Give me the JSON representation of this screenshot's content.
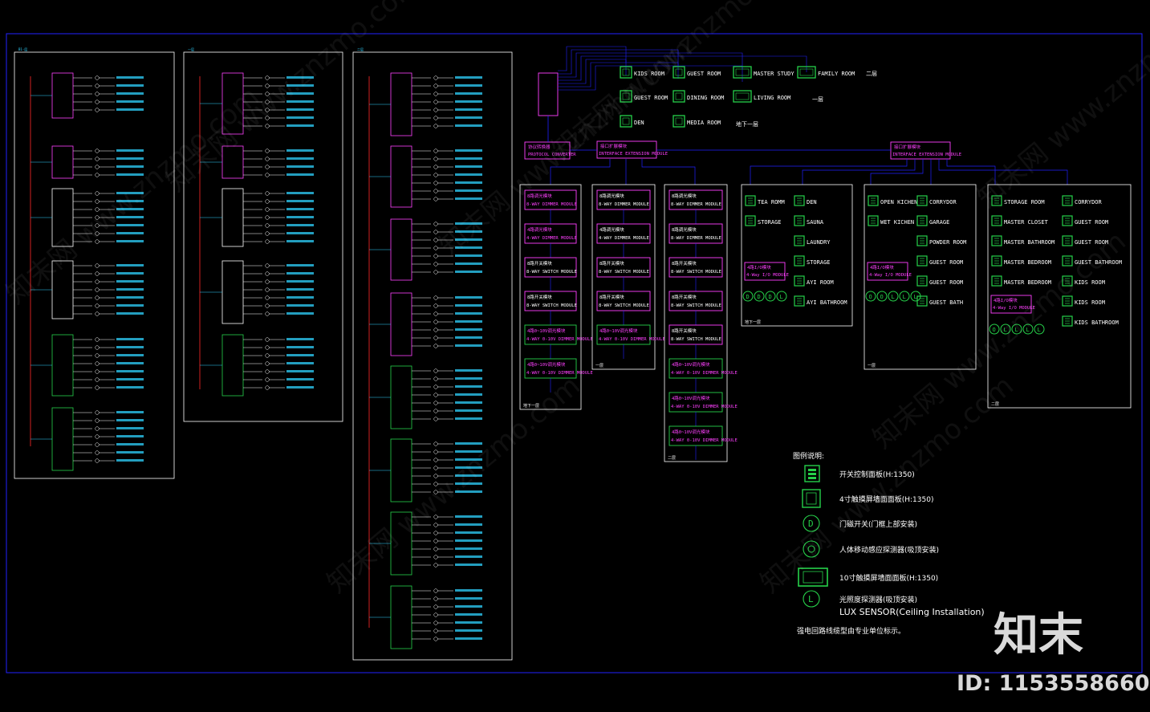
{
  "floors": {
    "f2_label": "二层",
    "f1_label": "一层",
    "fb1_label": "地下一层"
  },
  "touch_panel_rooms": [
    {
      "label": "KIDS ROOM"
    },
    {
      "label": "GUEST ROOM"
    },
    {
      "label": "MASTER STUDY"
    },
    {
      "label": "FAMILY ROOM"
    },
    {
      "label": "GUEST ROOM"
    },
    {
      "label": "DINING ROOM"
    },
    {
      "label": "LIVING ROOM"
    },
    {
      "label": "DEN"
    },
    {
      "label": "MEDIA ROOM"
    }
  ],
  "converter": {
    "cn": "协议转换器",
    "en": "PROTOCOL CONVERTER"
  },
  "extension_modules": [
    {
      "cn": "接口扩展模块",
      "en": "INTERFACE EXTENSION MODULE"
    },
    {
      "cn": "接口扩展模块",
      "en": "INTERFACE EXTENSION MODULE"
    }
  ],
  "module_columns": [
    {
      "floor": "地下一层",
      "modules": [
        {
          "cn": "8路调光模块",
          "en": "8-WAY DIMMER MODULE",
          "color": "#ff40ff"
        },
        {
          "cn": "4路调光模块",
          "en": "4-WAY DIMMER MODULE",
          "color": "#ff40ff"
        },
        {
          "cn": "8路开关模块",
          "en": "8-WAY SWITCH MODULE",
          "color": "#ffffff"
        },
        {
          "cn": "8路开关模块",
          "en": "8-WAY SWITCH MODULE",
          "color": "#ffffff"
        },
        {
          "cn": "4路0~10V调光模块",
          "en": "4-WAY 0-10V DIMMER MODULE",
          "color": "#ff40ff"
        },
        {
          "cn": "4路0~10V调光模块",
          "en": "4-WAY 0-10V DIMMER MODULE",
          "color": "#ff40ff"
        }
      ]
    },
    {
      "floor": "一层",
      "modules": [
        {
          "cn": "8路调光模块",
          "en": "8-WAY DIMMER MODULE",
          "color": "#ffffff"
        },
        {
          "cn": "4路调光模块",
          "en": "4-WAY DIMMER MODULE",
          "color": "#ffffff"
        },
        {
          "cn": "8路开关模块",
          "en": "8-WAY SWITCH MODULE",
          "color": "#ffffff"
        },
        {
          "cn": "8路开关模块",
          "en": "8-WAY SWITCH MODULE",
          "color": "#ffffff"
        },
        {
          "cn": "4路0~10V调光模块",
          "en": "4-WAY 0-10V DIMMER MODULE",
          "color": "#ff40ff"
        }
      ]
    },
    {
      "floor": "二层",
      "modules": [
        {
          "cn": "8路调光模块",
          "en": "8-WAY DIMMER MODULE",
          "color": "#ffffff"
        },
        {
          "cn": "8路调光模块",
          "en": "8-WAY DIMMER MODULE",
          "color": "#ffffff"
        },
        {
          "cn": "8路开关模块",
          "en": "8-WAY SWITCH MODULE",
          "color": "#ffffff"
        },
        {
          "cn": "8路开关模块",
          "en": "8-WAY SWITCH MODULE",
          "color": "#ffffff"
        },
        {
          "cn": "8路开关模块",
          "en": "8-WAY SWITCH MODULE",
          "color": "#ffffff"
        },
        {
          "cn": "4路0~10V调光模块",
          "en": "4-WAY 0-10V DIMMER MODULE",
          "color": "#ff40ff"
        },
        {
          "cn": "4路0~10V调光模块",
          "en": "4-WAY 0-10V DIMMER MODULE",
          "color": "#ff40ff"
        },
        {
          "cn": "4路0~10V调光模块",
          "en": "4-WAY 0-10V DIMMER MODULE",
          "color": "#ff40ff"
        }
      ]
    }
  ],
  "panel_groups": [
    {
      "floor": "地下一层",
      "left": [
        "TEA ROMM",
        "STORAGE"
      ],
      "right": [
        "DEN",
        "SAUNA",
        "LAUNDRY",
        "STORAGE",
        "AYI ROOM",
        "AYI BATHROOM"
      ],
      "io": "4路I/O模块",
      "io_en": "4-Way I/O MODULE",
      "sensors": [
        "D",
        "D",
        "D",
        "L"
      ]
    },
    {
      "floor": "一层",
      "left": [
        "OPEN KICHEN",
        "WET KICHEN"
      ],
      "right": [
        "CORRYDOR",
        "GARAGE",
        "POWDER ROOM",
        "GUEST ROOM",
        "GUEST ROOM",
        "GUEST BATH"
      ],
      "io": "4路I/O模块",
      "io_en": "4-Way I/O MODULE",
      "sensors": [
        "O",
        "O",
        "L",
        "L",
        "L"
      ]
    },
    {
      "floor": "二层",
      "left": [
        "STORAGE ROOM",
        "MASTER CLOSET",
        "MASTER BATHROOM",
        "MASTER BEDROOM",
        "MASTER BEDROOM"
      ],
      "right": [
        "CORRYDOR",
        "GUEST ROOM",
        "GUEST ROOM",
        "GUEST BATHROOM",
        "KIDS ROOM",
        "KIDS ROOM",
        "KIDS BATHROOM"
      ],
      "io": "4路I/O模块",
      "io_en": "4-Way I/O MODULE",
      "sensors": [
        "O",
        "L",
        "L",
        "L",
        "L"
      ]
    }
  ],
  "legend": {
    "title": "图例说明:",
    "items": [
      {
        "icon": "switch-panel-icon",
        "text": "开关控制面板(H:1350)"
      },
      {
        "icon": "touch-panel-4-icon",
        "text": "4寸触摸屏墙面面板(H:1350)"
      },
      {
        "icon": "door-switch-icon",
        "text": "门磁开关(门框上部安装)"
      },
      {
        "icon": "motion-sensor-icon",
        "text": "人体移动感应探测器(吸顶安装)"
      },
      {
        "icon": "touch-panel-10-icon",
        "text": "10寸触摸屏墙面面板(H:1350)"
      },
      {
        "icon": "lux-sensor-icon",
        "text": "光照度探测器(吸顶安装)",
        "sub": "LUX SENSOR(Ceiling Installation)"
      }
    ],
    "note": "强电回路线缆型由专业单位标示。"
  },
  "panels": {
    "top_labels": [
      "B1-层",
      "一层",
      "二层"
    ]
  },
  "brand": {
    "logo": "知末",
    "id_text": "ID: 1153558660"
  },
  "watermark": "知末网 www.znzmo.com",
  "colors": {
    "background": "#000000",
    "frame": "#2222ff",
    "room_text": "#ffffff",
    "module": "#ff40ff",
    "icon_green": "#26d14a",
    "wire_blue": "#2020ff",
    "wire_cyan": "#2fd3ff",
    "bus_red": "#d02020"
  }
}
